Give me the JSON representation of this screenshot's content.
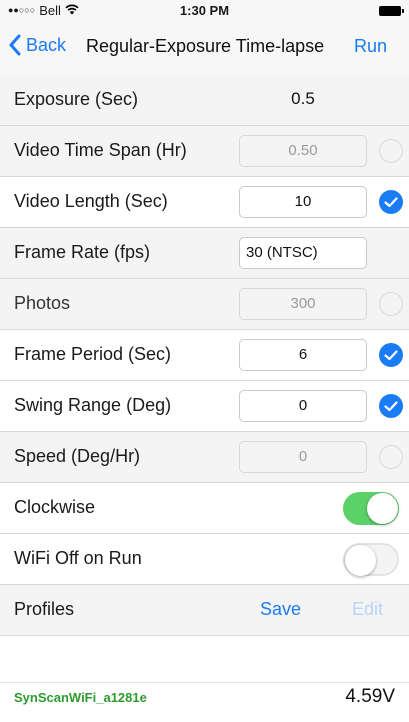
{
  "status_bar": {
    "signal_dots": "●●○○○",
    "carrier": "Bell",
    "time": "1:30 PM"
  },
  "nav": {
    "back_label": "Back",
    "title": "Regular-Exposure Time-lapse",
    "run_label": "Run"
  },
  "rows": {
    "exposure": {
      "label": "Exposure (Sec)",
      "value": "0.5"
    },
    "video_time_span": {
      "label": "Video Time Span (Hr)",
      "value": "0.50",
      "checked": false
    },
    "video_length": {
      "label": "Video Length (Sec)",
      "value": "10",
      "checked": true
    },
    "frame_rate": {
      "label": "Frame Rate (fps)",
      "value": "30 (NTSC)"
    },
    "photos": {
      "label": "Photos",
      "value": "300",
      "checked": false
    },
    "frame_period": {
      "label": "Frame Period (Sec)",
      "value": "6",
      "checked": true
    },
    "swing_range": {
      "label": "Swing Range (Deg)",
      "value": "0",
      "checked": true
    },
    "speed": {
      "label": "Speed (Deg/Hr)",
      "value": "0",
      "checked": false
    },
    "clockwise": {
      "label": "Clockwise",
      "on": true
    },
    "wifi_off": {
      "label": "WiFi Off on Run",
      "on": false
    },
    "profiles": {
      "label": "Profiles",
      "save_label": "Save",
      "edit_label": "Edit"
    }
  },
  "footer": {
    "device": "SynScanWiFi_a1281e",
    "voltage": "4.59V"
  },
  "colors": {
    "accent": "#1a7cf5",
    "toggle_on": "#5cd168",
    "device_name": "#2d9b2d"
  },
  "icons": {
    "back": "chevron-left-icon",
    "check": "checkmark-icon",
    "wifi": "wifi-icon",
    "battery": "battery-icon"
  }
}
